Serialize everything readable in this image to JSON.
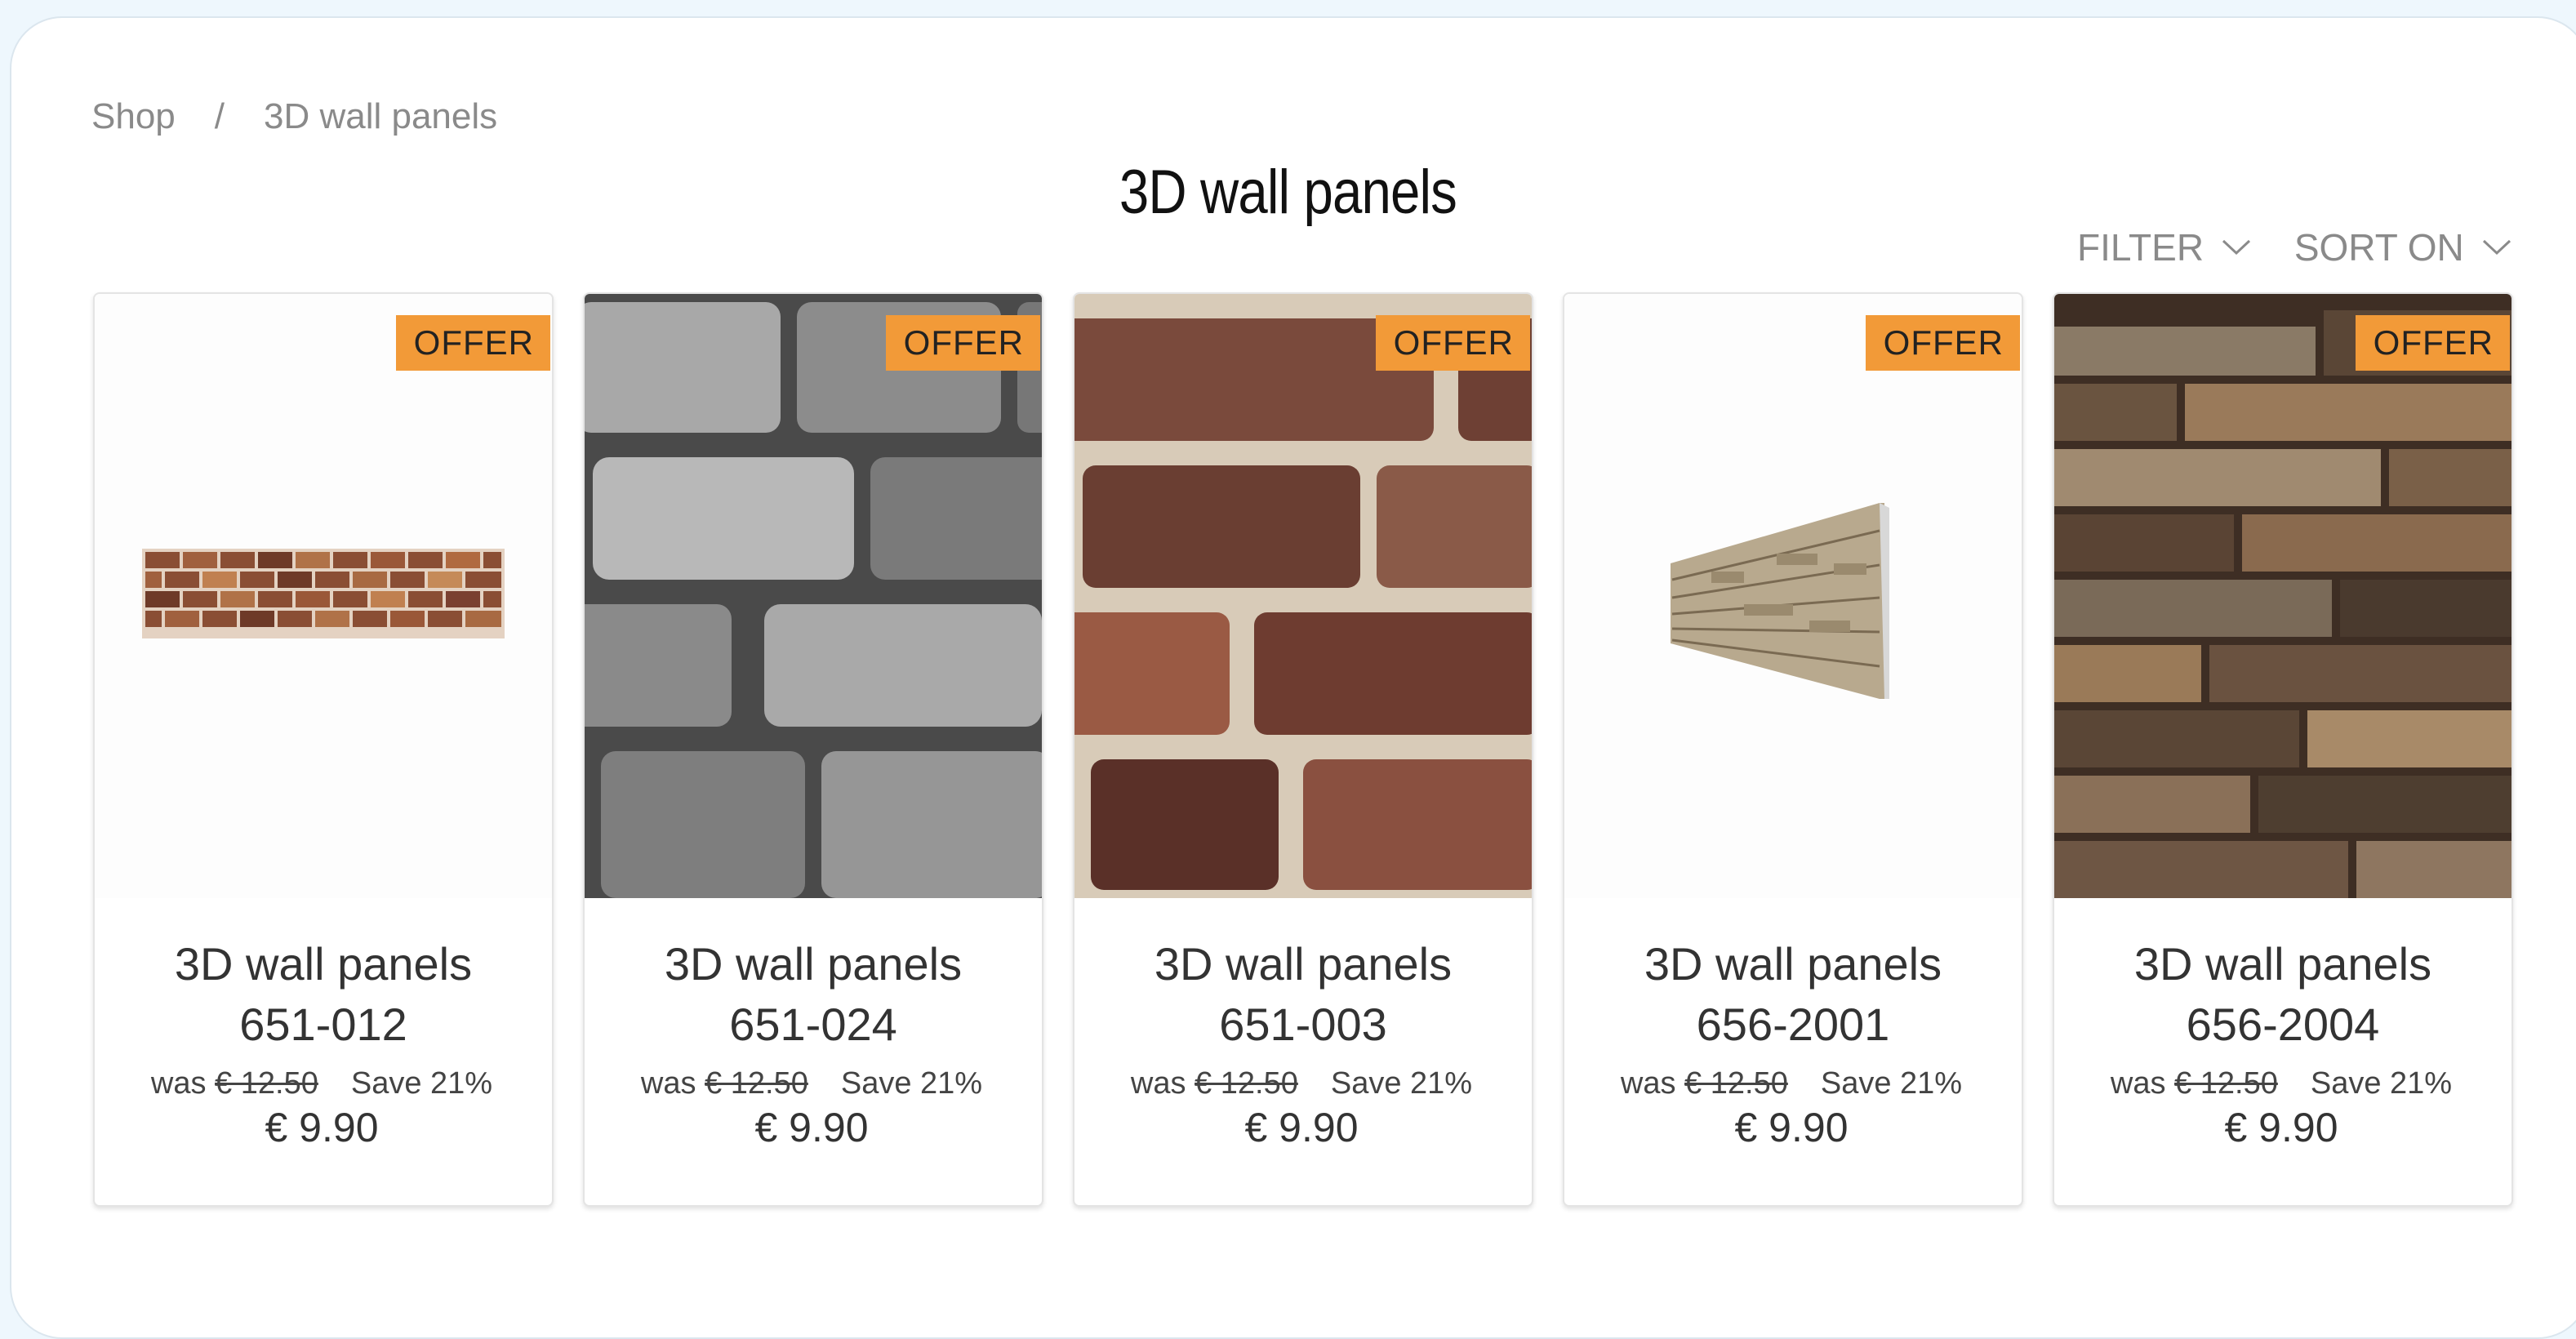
{
  "breadcrumb": {
    "home": "Shop",
    "separator": "/",
    "current": "3D wall panels"
  },
  "page": {
    "title": "3D wall panels"
  },
  "controls": {
    "filter": "FILTER",
    "sort": "SORT ON"
  },
  "products": [
    {
      "title": "3D wall panels",
      "code": "651-012",
      "badge": "OFFER",
      "was_label": "was",
      "old_price": "€ 12.50",
      "save": "Save 21%",
      "price": "€ 9.90"
    },
    {
      "title": "3D wall panels",
      "code": "651-024",
      "badge": "OFFER",
      "was_label": "was",
      "old_price": "€ 12.50",
      "save": "Save 21%",
      "price": "€ 9.90"
    },
    {
      "title": "3D wall panels",
      "code": "651-003",
      "badge": "OFFER",
      "was_label": "was",
      "old_price": "€ 12.50",
      "save": "Save 21%",
      "price": "€ 9.90"
    },
    {
      "title": "3D wall panels",
      "code": "656-2001",
      "badge": "OFFER",
      "was_label": "was",
      "old_price": "€ 12.50",
      "save": "Save 21%",
      "price": "€ 9.90"
    },
    {
      "title": "3D wall panels",
      "code": "656-2004",
      "badge": "OFFER",
      "was_label": "was",
      "old_price": "€ 12.50",
      "save": "Save 21%",
      "price": "€ 9.90"
    }
  ],
  "colors": {
    "badge": "#f29a38",
    "background": "#eef7fd"
  },
  "icons": {
    "dropdown": "chevron-down-icon"
  }
}
